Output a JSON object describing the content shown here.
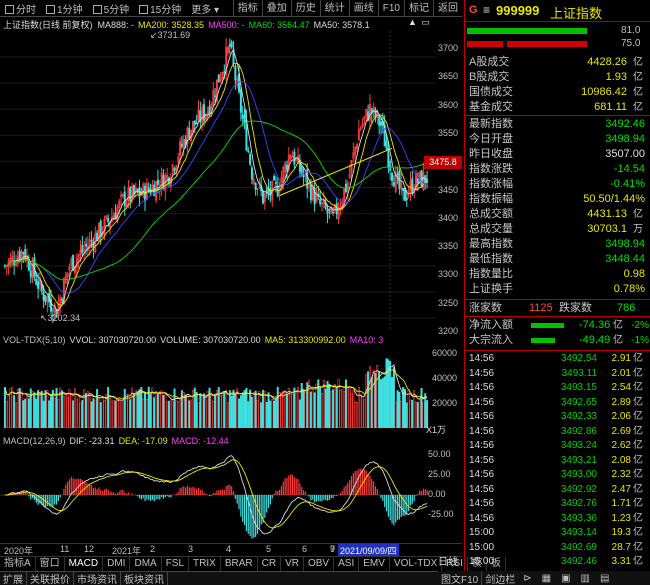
{
  "toolbar": {
    "left": [
      "分时",
      "1分钟",
      "5分钟",
      "15分钟",
      "更多"
    ],
    "right": [
      "指标",
      "叠加",
      "历史",
      "统计",
      "画线",
      "F10",
      "标记",
      "返回"
    ]
  },
  "main": {
    "title": "上证指数(日线 前复权)",
    "legend": [
      {
        "label": "MA888: -",
        "color": "#dcdcdc"
      },
      {
        "label": "MA200: 3528.35",
        "color": "#e8e800"
      },
      {
        "label": "MA500: -",
        "color": "#ff40ff"
      },
      {
        "label": "MA60: 3564.47",
        "color": "#00e000"
      },
      {
        "label": "MA50: 3578.1",
        "color": "#dcdcdc"
      }
    ],
    "high_label": "3731.69",
    "low_label": "3202.34",
    "price_tag": "3475.8",
    "y_ticks": [
      "3700",
      "3650",
      "3600",
      "3550",
      "3500",
      "3450",
      "3400",
      "3350",
      "3300",
      "3250",
      "3200"
    ]
  },
  "volume": {
    "legend": [
      {
        "label": "VOL-TDX(5,10)",
        "color": "#c0c0c0"
      },
      {
        "label": "VVOL: 307030720.00",
        "color": "#dcdcdc"
      },
      {
        "label": "VOLUME: 307030720.00",
        "color": "#dcdcdc"
      },
      {
        "label": "MA5: 313300992.00",
        "color": "#e8e800"
      },
      {
        "label": "MA10: 3",
        "color": "#ff40ff"
      }
    ],
    "y_ticks": [
      "60000",
      "40000",
      "20000"
    ],
    "unit": "X1万"
  },
  "macd": {
    "legend": [
      {
        "label": "MACD(12,26,9)",
        "color": "#c0c0c0"
      },
      {
        "label": "DIF: -23.31",
        "color": "#dcdcdc"
      },
      {
        "label": "DEA: -17.09",
        "color": "#e8e800"
      },
      {
        "label": "MACD: -12.44",
        "color": "#ff40ff"
      }
    ],
    "y_ticks": [
      "50.00",
      "25.00",
      "0.00",
      "-25.00"
    ]
  },
  "xaxis": {
    "labels": [
      "2020年",
      "11",
      "12",
      "2021年",
      "2",
      "3",
      "4",
      "5",
      "6",
      "7",
      "8",
      "9"
    ],
    "cursor_date": "2021/09/09/四",
    "right_label": "日线"
  },
  "subtabs": [
    "指标A",
    "窗口",
    "MACD",
    "DMI",
    "DMA",
    "FSL",
    "TRIX",
    "BRAR",
    "CR",
    "VR",
    "OBV",
    "ASI",
    "EMV",
    "VOL-TDX",
    "RSI",
    "模",
    "板"
  ],
  "bottom_tabs": [
    "扩展",
    "关联报价",
    "市场资讯",
    "板块资讯"
  ],
  "bottom_right": [
    "图文F10",
    "剑边栏"
  ],
  "quote": {
    "code": "999999",
    "name": "上证指数",
    "bar1": "81.0",
    "bar2": "75.0",
    "turnover": [
      {
        "label": "A股成交",
        "value": "4428.26",
        "unit": "亿"
      },
      {
        "label": "B股成交",
        "value": "1.93",
        "unit": "亿"
      },
      {
        "label": "国债成交",
        "value": "10986.42",
        "unit": "亿"
      },
      {
        "label": "基金成交",
        "value": "681.11",
        "unit": "亿"
      }
    ],
    "stats": [
      {
        "label": "最新指数",
        "value": "3492.46",
        "color": "#00e000",
        "unit": ""
      },
      {
        "label": "今日开盘",
        "value": "3498.94",
        "color": "#00e000",
        "unit": ""
      },
      {
        "label": "昨日收盘",
        "value": "3507.00",
        "color": "#e0e0e0",
        "unit": ""
      },
      {
        "label": "指数涨跌",
        "value": "-14.54",
        "color": "#00e000",
        "unit": ""
      },
      {
        "label": "指数涨幅",
        "value": "-0.41%",
        "color": "#00e000",
        "unit": ""
      },
      {
        "label": "指数振幅",
        "value": "50.50/1.44%",
        "color": "#e8e800",
        "unit": ""
      },
      {
        "label": "总成交额",
        "value": "4431.13",
        "color": "#e8e800",
        "unit": "亿"
      },
      {
        "label": "总成交量",
        "value": "30703.1",
        "color": "#e8e800",
        "unit": "万"
      },
      {
        "label": "最高指数",
        "value": "3498.94",
        "color": "#00e000",
        "unit": ""
      },
      {
        "label": "最低指数",
        "value": "3448.44",
        "color": "#00e000",
        "unit": ""
      },
      {
        "label": "指数量比",
        "value": "0.98",
        "color": "#e8e800",
        "unit": ""
      },
      {
        "label": "上证换手",
        "value": "0.78%",
        "color": "#e8e800",
        "unit": ""
      }
    ],
    "up_label": "涨家数",
    "up_count": "1125",
    "down_label": "跌家数",
    "down_count": "786",
    "flows": [
      {
        "label": "净流入额",
        "value": "-74.36",
        "unit": "亿",
        "pct": "-2%",
        "fill": 0.55
      },
      {
        "label": "大宗流入",
        "value": "-49.49",
        "unit": "亿",
        "pct": "-1%",
        "fill": 0.4
      }
    ],
    "ticks": [
      {
        "time": "14:56",
        "price": "3492.54",
        "vol": "2.91",
        "unit": "亿"
      },
      {
        "time": "14:56",
        "price": "3493.11",
        "vol": "2.01",
        "unit": "亿"
      },
      {
        "time": "14:56",
        "price": "3493.15",
        "vol": "2.54",
        "unit": "亿"
      },
      {
        "time": "14:56",
        "price": "3492.65",
        "vol": "2.89",
        "unit": "亿"
      },
      {
        "time": "14:56",
        "price": "3492.33",
        "vol": "2.06",
        "unit": "亿"
      },
      {
        "time": "14:56",
        "price": "3492.86",
        "vol": "2.69",
        "unit": "亿"
      },
      {
        "time": "14:56",
        "price": "3493.24",
        "vol": "2.62",
        "unit": "亿"
      },
      {
        "time": "14:56",
        "price": "3493.21",
        "vol": "2.08",
        "unit": "亿"
      },
      {
        "time": "14:56",
        "price": "3493.00",
        "vol": "2.32",
        "unit": "亿"
      },
      {
        "time": "14:56",
        "price": "3492.92",
        "vol": "2.47",
        "unit": "亿"
      },
      {
        "time": "14:56",
        "price": "3492.76",
        "vol": "1.71",
        "unit": "亿"
      },
      {
        "time": "14:56",
        "price": "3493.36",
        "vol": "1.23",
        "unit": "亿"
      },
      {
        "time": "15:00",
        "price": "3493.14",
        "vol": "19.3",
        "unit": "亿"
      },
      {
        "time": "15:00",
        "price": "3492.69",
        "vol": "28.7",
        "unit": "亿"
      },
      {
        "time": "15:00",
        "price": "3492.46",
        "vol": "3.31",
        "unit": "亿"
      }
    ]
  },
  "colors": {
    "up": "#ff3c3c",
    "down": "#40e0e0",
    "ma_white": "#dcdcdc",
    "ma_yellow": "#e8e800",
    "ma_green": "#00e000",
    "ma_blue": "#4040ff"
  }
}
